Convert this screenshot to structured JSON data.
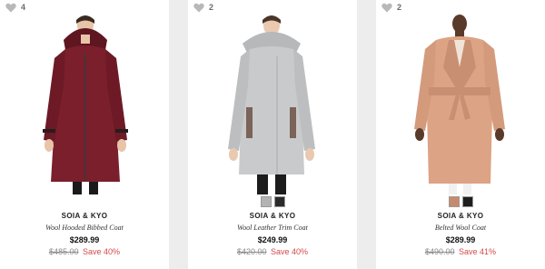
{
  "products": [
    {
      "favorites_count": "4",
      "brand": "SOIA & KYO",
      "name": "Wool Hooded Bibbed Coat",
      "price": "$289.99",
      "original_price": "$485.00",
      "savings": "Save 40%",
      "coat_color": "#7a1f2b",
      "swatches": []
    },
    {
      "favorites_count": "2",
      "brand": "SOIA & KYO",
      "name": "Wool Leather Trim Coat",
      "price": "$249.99",
      "original_price": "$420.00",
      "savings": "Save 40%",
      "coat_color": "#c9cacb",
      "swatches": [
        "#b3b3b3",
        "#2a2a2a"
      ]
    },
    {
      "favorites_count": "2",
      "brand": "SOIA & KYO",
      "name": "Belted Wool Coat",
      "price": "$289.99",
      "original_price": "$490.00",
      "savings": "Save 41%",
      "coat_color": "#dca385",
      "swatches": [
        "#c88a6c",
        "#1e1e1e"
      ]
    }
  ],
  "colors": {
    "background": "#ededed",
    "card": "#ffffff",
    "save_red": "#d24a4a",
    "heart_gray": "#b8b8b8"
  }
}
